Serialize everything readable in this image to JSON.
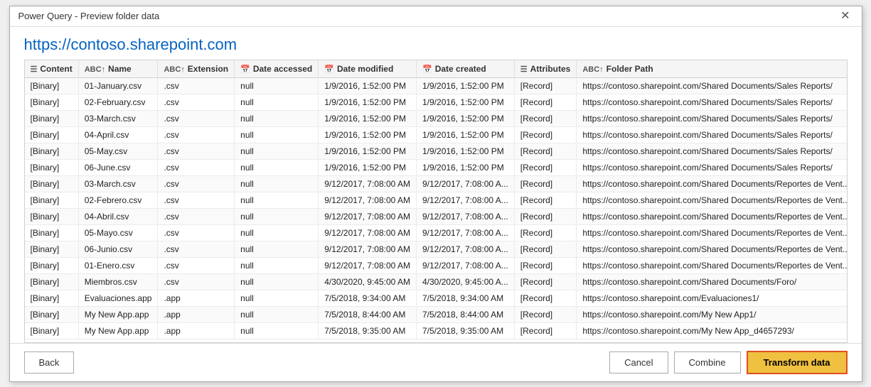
{
  "titleBar": {
    "title": "Power Query - Preview folder data",
    "closeLabel": "✕"
  },
  "header": {
    "url": "https://contoso.sharepoint.com"
  },
  "columns": [
    {
      "icon": "☰",
      "label": "Content"
    },
    {
      "icon": "ABC↑",
      "label": "Name"
    },
    {
      "icon": "ABC↑",
      "label": "Extension"
    },
    {
      "icon": "📅",
      "label": "Date accessed"
    },
    {
      "icon": "📅",
      "label": "Date modified"
    },
    {
      "icon": "📅",
      "label": "Date created"
    },
    {
      "icon": "☰",
      "label": "Attributes"
    },
    {
      "icon": "ABC↑",
      "label": "Folder Path"
    }
  ],
  "rows": [
    [
      "[Binary]",
      "01-January.csv",
      ".csv",
      "null",
      "1/9/2016, 1:52:00 PM",
      "1/9/2016, 1:52:00 PM",
      "[Record]",
      "https://contoso.sharepoint.com/Shared Documents/Sales Reports/"
    ],
    [
      "[Binary]",
      "02-February.csv",
      ".csv",
      "null",
      "1/9/2016, 1:52:00 PM",
      "1/9/2016, 1:52:00 PM",
      "[Record]",
      "https://contoso.sharepoint.com/Shared Documents/Sales Reports/"
    ],
    [
      "[Binary]",
      "03-March.csv",
      ".csv",
      "null",
      "1/9/2016, 1:52:00 PM",
      "1/9/2016, 1:52:00 PM",
      "[Record]",
      "https://contoso.sharepoint.com/Shared Documents/Sales Reports/"
    ],
    [
      "[Binary]",
      "04-April.csv",
      ".csv",
      "null",
      "1/9/2016, 1:52:00 PM",
      "1/9/2016, 1:52:00 PM",
      "[Record]",
      "https://contoso.sharepoint.com/Shared Documents/Sales Reports/"
    ],
    [
      "[Binary]",
      "05-May.csv",
      ".csv",
      "null",
      "1/9/2016, 1:52:00 PM",
      "1/9/2016, 1:52:00 PM",
      "[Record]",
      "https://contoso.sharepoint.com/Shared Documents/Sales Reports/"
    ],
    [
      "[Binary]",
      "06-June.csv",
      ".csv",
      "null",
      "1/9/2016, 1:52:00 PM",
      "1/9/2016, 1:52:00 PM",
      "[Record]",
      "https://contoso.sharepoint.com/Shared Documents/Sales Reports/"
    ],
    [
      "[Binary]",
      "03-March.csv",
      ".csv",
      "null",
      "9/12/2017, 7:08:00 AM",
      "9/12/2017, 7:08:00 A...",
      "[Record]",
      "https://contoso.sharepoint.com/Shared Documents/Reportes de Vent..."
    ],
    [
      "[Binary]",
      "02-Febrero.csv",
      ".csv",
      "null",
      "9/12/2017, 7:08:00 AM",
      "9/12/2017, 7:08:00 A...",
      "[Record]",
      "https://contoso.sharepoint.com/Shared Documents/Reportes de Vent..."
    ],
    [
      "[Binary]",
      "04-Abril.csv",
      ".csv",
      "null",
      "9/12/2017, 7:08:00 AM",
      "9/12/2017, 7:08:00 A...",
      "[Record]",
      "https://contoso.sharepoint.com/Shared Documents/Reportes de Vent..."
    ],
    [
      "[Binary]",
      "05-Mayo.csv",
      ".csv",
      "null",
      "9/12/2017, 7:08:00 AM",
      "9/12/2017, 7:08:00 A...",
      "[Record]",
      "https://contoso.sharepoint.com/Shared Documents/Reportes de Vent..."
    ],
    [
      "[Binary]",
      "06-Junio.csv",
      ".csv",
      "null",
      "9/12/2017, 7:08:00 AM",
      "9/12/2017, 7:08:00 A...",
      "[Record]",
      "https://contoso.sharepoint.com/Shared Documents/Reportes de Vent..."
    ],
    [
      "[Binary]",
      "01-Enero.csv",
      ".csv",
      "null",
      "9/12/2017, 7:08:00 AM",
      "9/12/2017, 7:08:00 A...",
      "[Record]",
      "https://contoso.sharepoint.com/Shared Documents/Reportes de Vent..."
    ],
    [
      "[Binary]",
      "Miembros.csv",
      ".csv",
      "null",
      "4/30/2020, 9:45:00 AM",
      "4/30/2020, 9:45:00 A...",
      "[Record]",
      "https://contoso.sharepoint.com/Shared Documents/Foro/"
    ],
    [
      "[Binary]",
      "Evaluaciones.app",
      ".app",
      "null",
      "7/5/2018, 9:34:00 AM",
      "7/5/2018, 9:34:00 AM",
      "[Record]",
      "https://contoso.sharepoint.com/Evaluaciones1/"
    ],
    [
      "[Binary]",
      "My New App.app",
      ".app",
      "null",
      "7/5/2018, 8:44:00 AM",
      "7/5/2018, 8:44:00 AM",
      "[Record]",
      "https://contoso.sharepoint.com/My New App1/"
    ],
    [
      "[Binary]",
      "My New App.app",
      ".app",
      "null",
      "7/5/2018, 9:35:00 AM",
      "7/5/2018, 9:35:00 AM",
      "[Record]",
      "https://contoso.sharepoint.com/My New App_d4657293/"
    ]
  ],
  "footer": {
    "backLabel": "Back",
    "cancelLabel": "Cancel",
    "combineLabel": "Combine",
    "transformLabel": "Transform data"
  }
}
